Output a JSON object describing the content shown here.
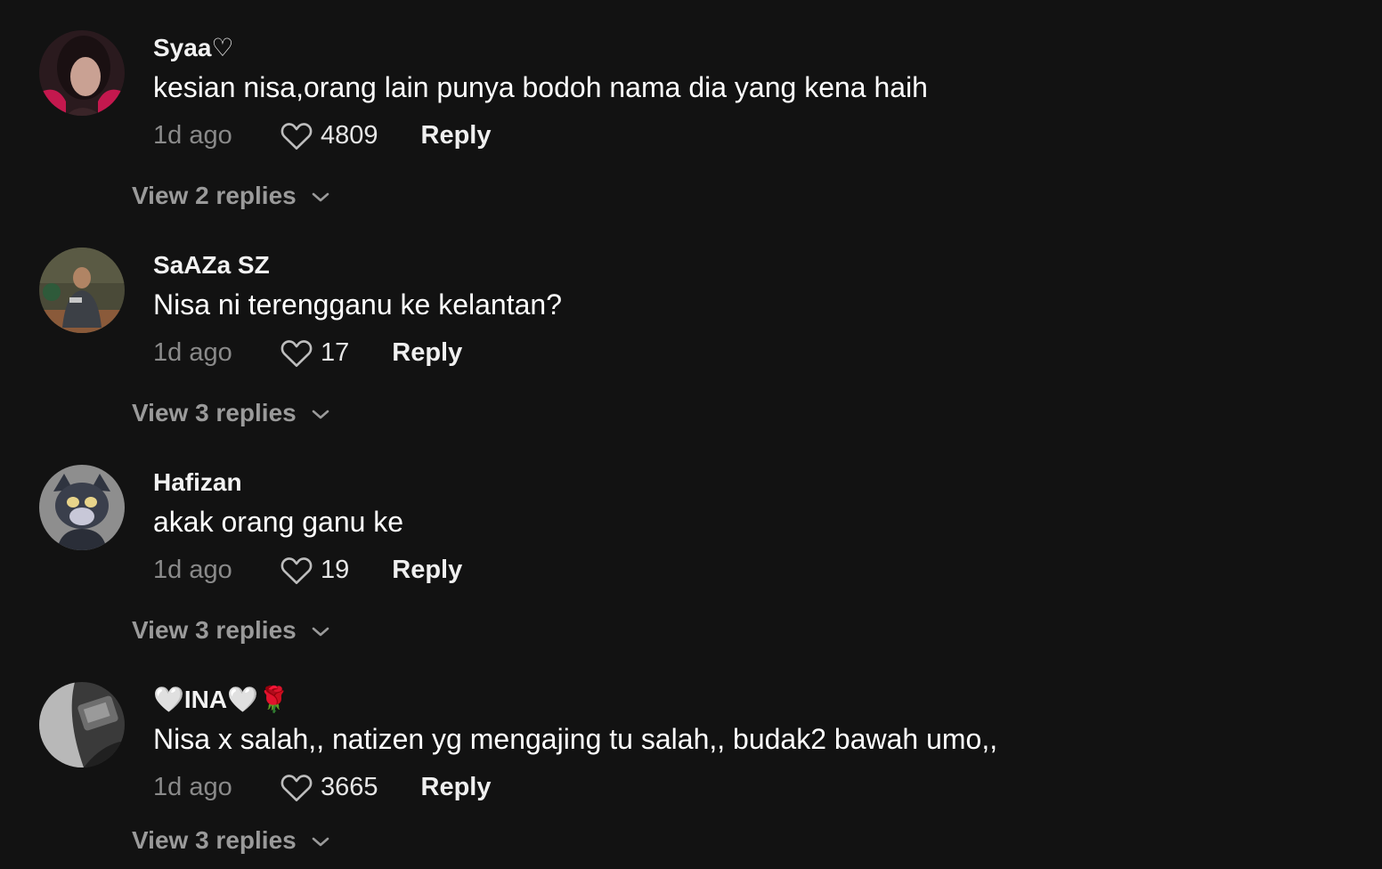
{
  "comments": [
    {
      "username": "Syaa♡",
      "text": "kesian nisa,orang lain punya bodoh nama dia yang kena haih",
      "time": "1d ago",
      "likes": "4809",
      "reply_label": "Reply",
      "view_replies": "View 2 replies"
    },
    {
      "username": "SaAZa SZ",
      "text": "Nisa ni terengganu ke kelantan?",
      "time": "1d ago",
      "likes": "17",
      "reply_label": "Reply",
      "view_replies": "View 3 replies"
    },
    {
      "username": "Hafizan",
      "text": "akak orang ganu ke",
      "time": "1d ago",
      "likes": "19",
      "reply_label": "Reply",
      "view_replies": "View 3 replies"
    },
    {
      "username": "🤍INA🤍🌹",
      "text": "Nisa x salah,, natizen yg mengajing tu salah,, budak2 bawah umo,,",
      "time": "1d ago",
      "likes": "3665",
      "reply_label": "Reply",
      "view_replies": "View 3 replies"
    }
  ],
  "icons": {
    "like": "heart-outline-icon",
    "expand": "chevron-down-icon"
  },
  "colors": {
    "background": "#121212",
    "muted_text": "#8a8a8a",
    "view_replies": "#9a9a9a"
  }
}
